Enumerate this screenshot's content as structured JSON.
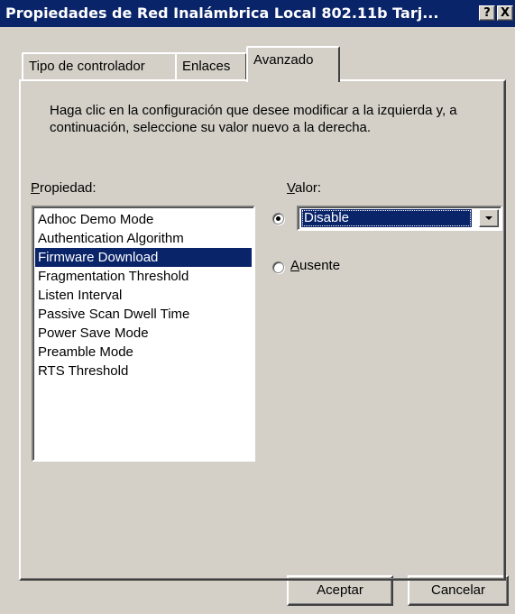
{
  "window": {
    "title": "Propiedades de Red Inalámbrica Local 802.11b Tarj...",
    "help_label": "?",
    "close_label": "X"
  },
  "tabs": [
    {
      "label": "Tipo de controlador",
      "active": false
    },
    {
      "label": "Enlaces",
      "active": false
    },
    {
      "label": "Avanzado",
      "active": true
    }
  ],
  "advanced": {
    "description": "Haga clic en la configuración que desee modificar a la izquierda y, a continuación, seleccione su valor nuevo a la derecha.",
    "property_label_accel": "P",
    "property_label_rest": "ropiedad:",
    "value_label_accel": "V",
    "value_label_rest": "alor:",
    "properties": [
      "Adhoc Demo Mode",
      "Authentication Algorithm",
      "Firmware Download",
      "Fragmentation Threshold",
      "Listen Interval",
      "Passive Scan Dwell Time",
      "Power Save Mode",
      "Preamble Mode",
      "RTS Threshold"
    ],
    "selected_property": "Firmware Download",
    "value_selected": "Disable",
    "absent_label_accel": "A",
    "absent_label_rest": "usente"
  },
  "buttons": {
    "ok_label": "Aceptar",
    "cancel_label": "Cancelar"
  }
}
